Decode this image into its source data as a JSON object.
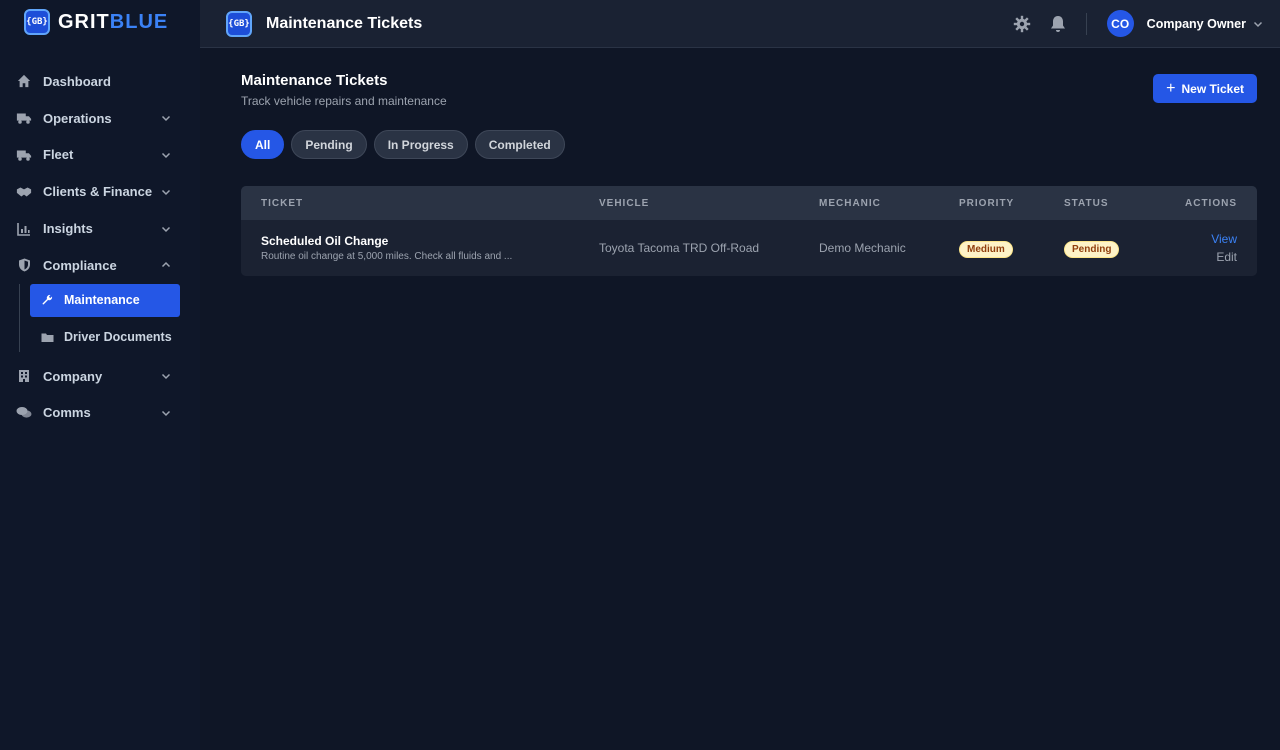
{
  "brand": {
    "badge": "{GB}",
    "name_part1": "GRIT",
    "name_part2": "BLUE"
  },
  "sidebar": {
    "items": [
      {
        "label": "Dashboard",
        "icon": "home-icon"
      },
      {
        "label": "Operations",
        "icon": "truck-icon"
      },
      {
        "label": "Fleet",
        "icon": "truck-icon"
      },
      {
        "label": "Clients & Finance",
        "icon": "handshake-icon"
      },
      {
        "label": "Insights",
        "icon": "chart-icon"
      },
      {
        "label": "Compliance",
        "icon": "shield-icon"
      },
      {
        "label": "Company",
        "icon": "building-icon"
      },
      {
        "label": "Comms",
        "icon": "chat-icon"
      }
    ],
    "compliance_sub": [
      {
        "label": "Maintenance",
        "icon": "wrench-icon"
      },
      {
        "label": "Driver Documents",
        "icon": "folder-icon"
      }
    ]
  },
  "topbar": {
    "badge": "{GB}",
    "title": "Maintenance Tickets",
    "avatar_initials": "CO",
    "user_name": "Company Owner"
  },
  "page": {
    "title": "Maintenance Tickets",
    "subtitle": "Track vehicle repairs and maintenance",
    "new_ticket_label": "New Ticket"
  },
  "filters": [
    "All",
    "Pending",
    "In Progress",
    "Completed"
  ],
  "table": {
    "headers": [
      "TICKET",
      "VEHICLE",
      "MECHANIC",
      "PRIORITY",
      "STATUS",
      "ACTIONS"
    ],
    "rows": [
      {
        "title": "Scheduled Oil Change",
        "description": "Routine oil change at 5,000 miles. Check all fluids and ...",
        "vehicle": "Toyota Tacoma TRD Off-Road",
        "mechanic": "Demo Mechanic",
        "priority": "Medium",
        "status": "Pending",
        "action_view": "View",
        "action_edit": "Edit"
      }
    ]
  },
  "colors": {
    "accent": "#2557e6",
    "brand_blue": "#3b82f6",
    "badge_bg": "#fef3c7"
  }
}
